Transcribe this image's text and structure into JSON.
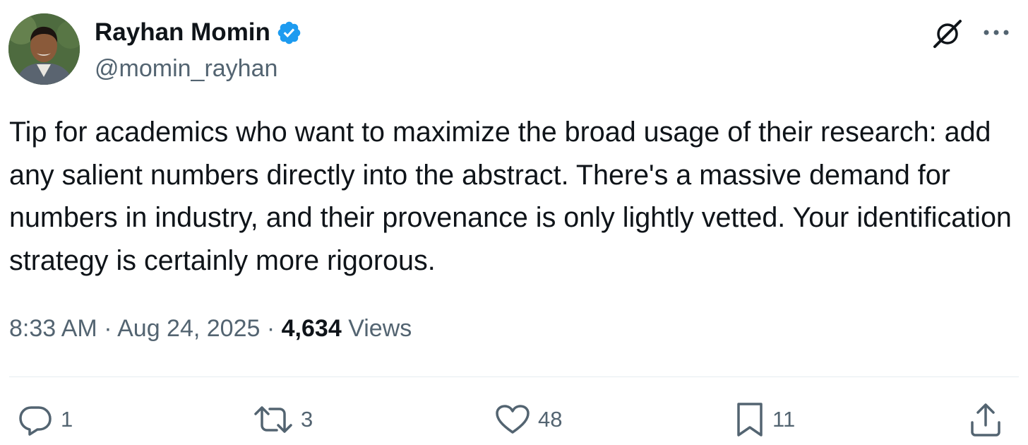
{
  "author": {
    "name": "Rayhan Momin",
    "handle": "@momin_rayhan",
    "verified": true,
    "verified_color": "#1d9bf0"
  },
  "header_icons": {
    "grok": "grok-slash-icon",
    "more": "more-horizontal-icon"
  },
  "tweet": {
    "text": "Tip for academics who want to maximize the broad usage of their research: add any salient numbers directly into the abstract. There's a massive demand for numbers in industry, and their provenance is only lightly vetted. Your identification strategy is certainly more rigorous."
  },
  "meta": {
    "time": "8:33 AM",
    "separator": "·",
    "date": "Aug 24, 2025",
    "views_count": "4,634",
    "views_label": "Views"
  },
  "actions": {
    "reply": {
      "icon": "reply-icon",
      "count": "1"
    },
    "retweet": {
      "icon": "retweet-icon",
      "count": "3"
    },
    "like": {
      "icon": "heart-icon",
      "count": "48"
    },
    "bookmark": {
      "icon": "bookmark-icon",
      "count": "11"
    },
    "share": {
      "icon": "share-icon"
    }
  },
  "colors": {
    "text_primary": "#0f1419",
    "text_secondary": "#536471",
    "divider": "#e6ecf0"
  }
}
